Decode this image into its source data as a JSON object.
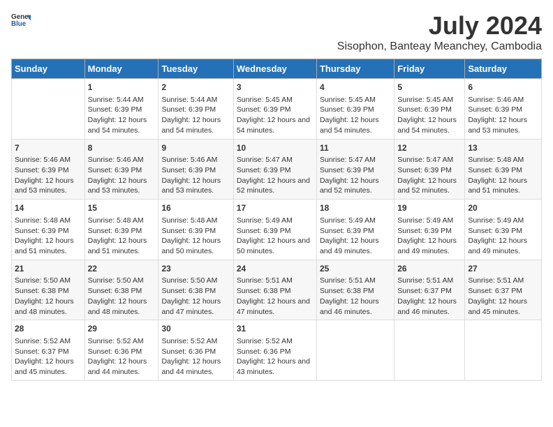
{
  "header": {
    "logo_general": "General",
    "logo_blue": "Blue",
    "title": "July 2024",
    "subtitle": "Sisophon, Banteay Meanchey, Cambodia"
  },
  "calendar": {
    "days_of_week": [
      "Sunday",
      "Monday",
      "Tuesday",
      "Wednesday",
      "Thursday",
      "Friday",
      "Saturday"
    ],
    "weeks": [
      [
        {
          "day": "",
          "info": ""
        },
        {
          "day": "1",
          "info": "Sunrise: 5:44 AM\nSunset: 6:39 PM\nDaylight: 12 hours and 54 minutes."
        },
        {
          "day": "2",
          "info": "Sunrise: 5:44 AM\nSunset: 6:39 PM\nDaylight: 12 hours and 54 minutes."
        },
        {
          "day": "3",
          "info": "Sunrise: 5:45 AM\nSunset: 6:39 PM\nDaylight: 12 hours and 54 minutes."
        },
        {
          "day": "4",
          "info": "Sunrise: 5:45 AM\nSunset: 6:39 PM\nDaylight: 12 hours and 54 minutes."
        },
        {
          "day": "5",
          "info": "Sunrise: 5:45 AM\nSunset: 6:39 PM\nDaylight: 12 hours and 54 minutes."
        },
        {
          "day": "6",
          "info": "Sunrise: 5:46 AM\nSunset: 6:39 PM\nDaylight: 12 hours and 53 minutes."
        }
      ],
      [
        {
          "day": "7",
          "info": "Sunrise: 5:46 AM\nSunset: 6:39 PM\nDaylight: 12 hours and 53 minutes."
        },
        {
          "day": "8",
          "info": "Sunrise: 5:46 AM\nSunset: 6:39 PM\nDaylight: 12 hours and 53 minutes."
        },
        {
          "day": "9",
          "info": "Sunrise: 5:46 AM\nSunset: 6:39 PM\nDaylight: 12 hours and 53 minutes."
        },
        {
          "day": "10",
          "info": "Sunrise: 5:47 AM\nSunset: 6:39 PM\nDaylight: 12 hours and 52 minutes."
        },
        {
          "day": "11",
          "info": "Sunrise: 5:47 AM\nSunset: 6:39 PM\nDaylight: 12 hours and 52 minutes."
        },
        {
          "day": "12",
          "info": "Sunrise: 5:47 AM\nSunset: 6:39 PM\nDaylight: 12 hours and 52 minutes."
        },
        {
          "day": "13",
          "info": "Sunrise: 5:48 AM\nSunset: 6:39 PM\nDaylight: 12 hours and 51 minutes."
        }
      ],
      [
        {
          "day": "14",
          "info": "Sunrise: 5:48 AM\nSunset: 6:39 PM\nDaylight: 12 hours and 51 minutes."
        },
        {
          "day": "15",
          "info": "Sunrise: 5:48 AM\nSunset: 6:39 PM\nDaylight: 12 hours and 51 minutes."
        },
        {
          "day": "16",
          "info": "Sunrise: 5:48 AM\nSunset: 6:39 PM\nDaylight: 12 hours and 50 minutes."
        },
        {
          "day": "17",
          "info": "Sunrise: 5:49 AM\nSunset: 6:39 PM\nDaylight: 12 hours and 50 minutes."
        },
        {
          "day": "18",
          "info": "Sunrise: 5:49 AM\nSunset: 6:39 PM\nDaylight: 12 hours and 49 minutes."
        },
        {
          "day": "19",
          "info": "Sunrise: 5:49 AM\nSunset: 6:39 PM\nDaylight: 12 hours and 49 minutes."
        },
        {
          "day": "20",
          "info": "Sunrise: 5:49 AM\nSunset: 6:39 PM\nDaylight: 12 hours and 49 minutes."
        }
      ],
      [
        {
          "day": "21",
          "info": "Sunrise: 5:50 AM\nSunset: 6:38 PM\nDaylight: 12 hours and 48 minutes."
        },
        {
          "day": "22",
          "info": "Sunrise: 5:50 AM\nSunset: 6:38 PM\nDaylight: 12 hours and 48 minutes."
        },
        {
          "day": "23",
          "info": "Sunrise: 5:50 AM\nSunset: 6:38 PM\nDaylight: 12 hours and 47 minutes."
        },
        {
          "day": "24",
          "info": "Sunrise: 5:51 AM\nSunset: 6:38 PM\nDaylight: 12 hours and 47 minutes."
        },
        {
          "day": "25",
          "info": "Sunrise: 5:51 AM\nSunset: 6:38 PM\nDaylight: 12 hours and 46 minutes."
        },
        {
          "day": "26",
          "info": "Sunrise: 5:51 AM\nSunset: 6:37 PM\nDaylight: 12 hours and 46 minutes."
        },
        {
          "day": "27",
          "info": "Sunrise: 5:51 AM\nSunset: 6:37 PM\nDaylight: 12 hours and 45 minutes."
        }
      ],
      [
        {
          "day": "28",
          "info": "Sunrise: 5:52 AM\nSunset: 6:37 PM\nDaylight: 12 hours and 45 minutes."
        },
        {
          "day": "29",
          "info": "Sunrise: 5:52 AM\nSunset: 6:36 PM\nDaylight: 12 hours and 44 minutes."
        },
        {
          "day": "30",
          "info": "Sunrise: 5:52 AM\nSunset: 6:36 PM\nDaylight: 12 hours and 44 minutes."
        },
        {
          "day": "31",
          "info": "Sunrise: 5:52 AM\nSunset: 6:36 PM\nDaylight: 12 hours and 43 minutes."
        },
        {
          "day": "",
          "info": ""
        },
        {
          "day": "",
          "info": ""
        },
        {
          "day": "",
          "info": ""
        }
      ]
    ]
  }
}
